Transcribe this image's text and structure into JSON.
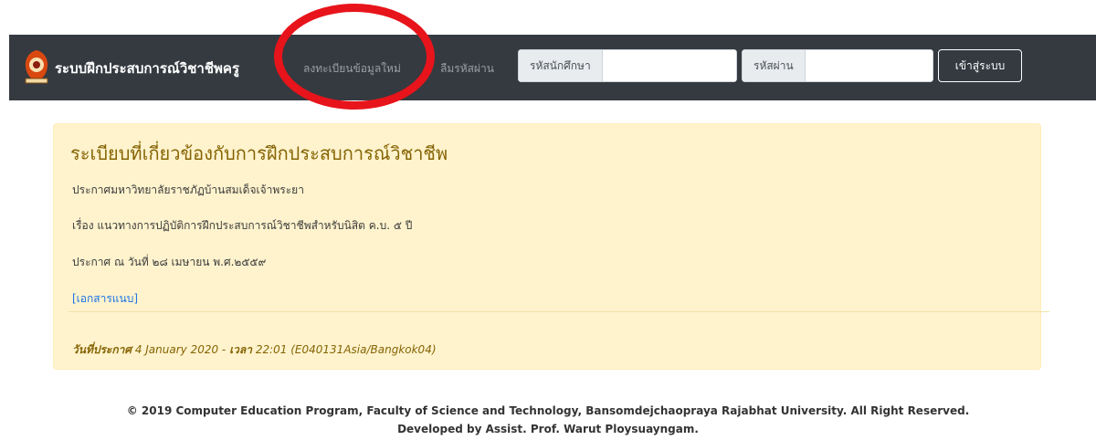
{
  "header": {
    "logo": "university-seal-logo",
    "brand": "ระบบฝึกประสบการณ์วิชาชีพครู",
    "register_link": "ลงทะเบียนข้อมูลใหม่",
    "forgot_link": "ลืมรหัสผ่าน",
    "student_id_label": "รหัสนักศึกษา",
    "student_id_value": "",
    "password_label": "รหัสผ่าน",
    "password_value": "",
    "login_button": "เข้าสู่ระบบ"
  },
  "annotation": {
    "color": "#e8141b",
    "shape": "circle"
  },
  "announcement": {
    "title": "ระเบียบที่เกี่ยวข้องกับการฝึกประสบการณ์วิชาชีพ",
    "line1": "ประกาศมหาวิทยาลัยราชภัฏบ้านสมเด็จเจ้าพระยา",
    "line2": "เรื่อง แนวทางการปฏิบัติการฝึกประสบการณ์วิชาชีพสำหรับนิสิต ค.บ. ๕ ปี",
    "line3": "ประกาศ ณ วันที่ ๒๘ เมษายน พ.ศ.๒๕๕๙",
    "attachment_link": "[เอกสารแนบ]",
    "date_label": "วันที่ประกาศ",
    "date_value": "4 January 2020 - ",
    "time_label": "เวลา",
    "time_value": "22:01 (E040131Asia/Bangkok04)"
  },
  "footer": {
    "line1": "© 2019 Computer Education Program, Faculty of Science and Technology, Bansomdejchaopraya Rajabhat University. All Right Reserved.",
    "line2": "Developed by Assist. Prof. Warut Ploysuayngam."
  },
  "colors": {
    "navbar": "#343a40",
    "alert_background": "#fff3cd",
    "alert_text": "#856404",
    "link": "#1a73e8"
  }
}
